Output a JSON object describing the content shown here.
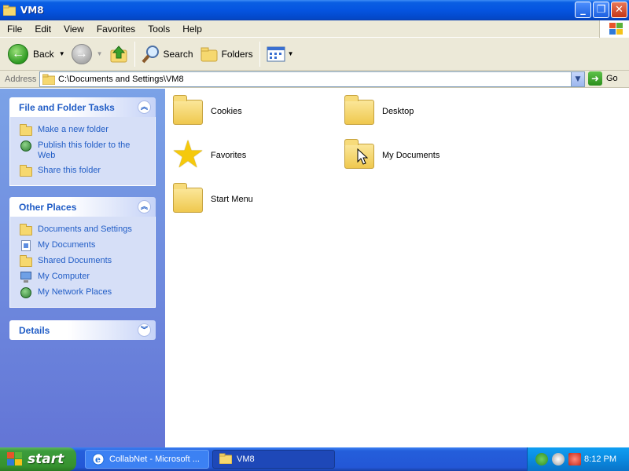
{
  "window": {
    "title": "VM8"
  },
  "menubar": {
    "items": [
      "File",
      "Edit",
      "View",
      "Favorites",
      "Tools",
      "Help"
    ]
  },
  "toolbar": {
    "back_label": "Back",
    "search_label": "Search",
    "folders_label": "Folders"
  },
  "address": {
    "label": "Address",
    "value": "C:\\Documents and Settings\\VM8",
    "go_label": "Go"
  },
  "taskpane": {
    "file_tasks": {
      "title": "File and Folder Tasks",
      "items": [
        "Make a new folder",
        "Publish this folder to the Web",
        "Share this folder"
      ]
    },
    "other_places": {
      "title": "Other Places",
      "items": [
        "Documents and Settings",
        "My Documents",
        "Shared Documents",
        "My Computer",
        "My Network Places"
      ]
    },
    "details": {
      "title": "Details"
    }
  },
  "content": {
    "items": [
      "Cookies",
      "Desktop",
      "Favorites",
      "My Documents",
      "Start Menu"
    ]
  },
  "taskbar": {
    "start_label": "start",
    "buttons": [
      "CollabNet - Microsoft ...",
      "VM8"
    ],
    "clock": "8:12 PM"
  },
  "colors": {
    "title_blue": "#0554e0",
    "taskpane_blue": "#6375d6",
    "link_blue": "#215dc6",
    "start_green": "#3c9c3c",
    "folder_yellow": "#f6d86f"
  }
}
